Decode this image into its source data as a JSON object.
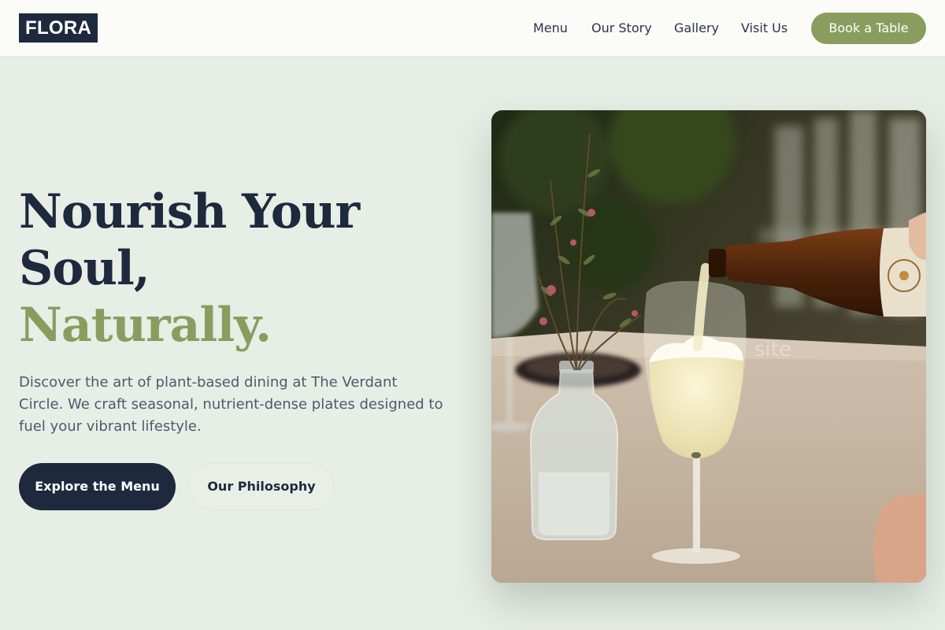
{
  "header": {
    "logo": "FLORA",
    "nav": [
      "Menu",
      "Our Story",
      "Gallery",
      "Visit Us"
    ],
    "cta": "Book a Table"
  },
  "hero": {
    "title_line1": "Nourish Your",
    "title_line2": "Soul,",
    "title_accent": "Naturally.",
    "description": "Discover the art of plant-based dining at The Verdant Circle. We craft seasonal, nutrient-dense plates designed to fuel your vibrant lifestyle.",
    "primary_button": "Explore the Menu",
    "secondary_button": "Our Philosophy",
    "image_watermark": "site"
  },
  "colors": {
    "navy": "#1e293d",
    "sage_accent": "#8a9d5f",
    "page_background": "#e7eee6",
    "header_background": "#fbfcf8",
    "body_text": "#4d5a6b"
  }
}
